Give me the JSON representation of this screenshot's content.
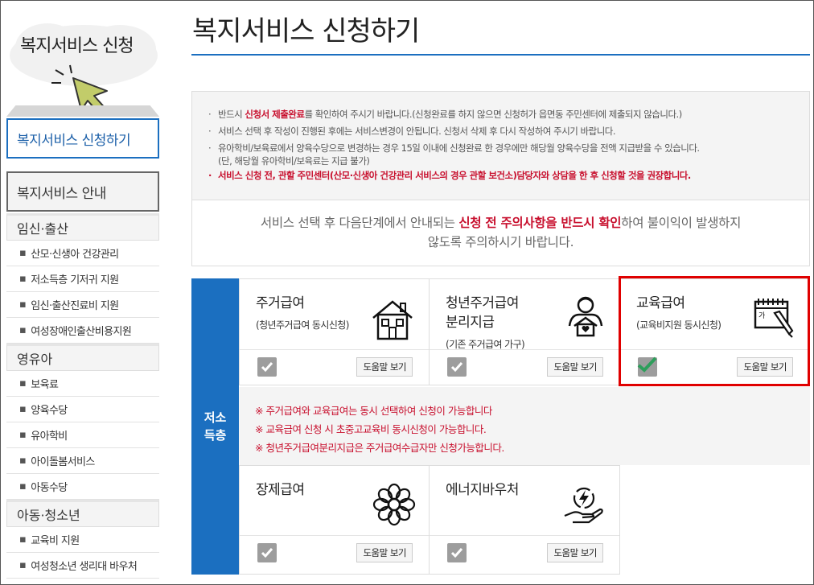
{
  "sidebar": {
    "title": "복지서비스 신청",
    "active_item": "복지서비스 신청하기",
    "guide_header": "복지서비스 안내",
    "categories": [
      {
        "label": "임신·출산",
        "items": [
          "산모·신생아 건강관리",
          "저소득층 기저귀 지원",
          "임신·출산진료비 지원",
          "여성장애인출산비용지원"
        ]
      },
      {
        "label": "영유아",
        "items": [
          "보육료",
          "양육수당",
          "유아학비",
          "아이돌봄서비스",
          "아동수당"
        ]
      },
      {
        "label": "아동·청소년",
        "items": [
          "교육비 지원",
          "여성청소년 생리대 바우처"
        ]
      }
    ]
  },
  "main": {
    "title": "복지서비스 신청하기",
    "notice": {
      "line1_pre": "반드시 ",
      "line1_red": "신청서 제출완료",
      "line1_post": "를 확인하여 주시기 바랍니다.(신청완료를 하지 않으면 신청허가 읍면동 주민센터에 제출되지 않습니다.)",
      "line2": "서비스 선택 후 작성이 진행된 후에는 서비스변경이 안됩니다. 신청서 삭제 후 다시 작성하여 주시기 바랍니다.",
      "line3": "유아학비/보육료에서 양육수당으로 변경하는 경우 15일 이내에 신청완료 한 경우에만 해당월 양육수당을 전액 지급받을 수 있습니다.",
      "line3_sub": "(단, 해당월 유아학비/보육료는 지급 불가)",
      "line4": "서비스 신청 전, 관할 주민센터(산모·신생아 건강관리 서비스의 경우 관할 보건소)담당자와 상담을 한 후 신청할 것을 권장합니다.",
      "bottom_pre": "서비스 선택 후 다음단계에서 안내되는 ",
      "bottom_red": "신청 전 주의사항을 반드시 확인",
      "bottom_post": "하여 불이익이 발생하지",
      "bottom_line2": "않도록 주의하시기 바랍니다."
    },
    "category_label_1": "저소",
    "category_label_2": "득층",
    "help_label": "도움말 보기",
    "cards": [
      {
        "name": "주거급여",
        "note": "(청년주거급여 동시신청)",
        "icon": "house-icon",
        "checked": false
      },
      {
        "name_1": "청년주거급여",
        "name_2": "분리지급",
        "note": "(기존 주거급여 가구)",
        "icon": "youth-house-icon",
        "checked": false
      },
      {
        "name": "교육급여",
        "note": "(교육비지원 동시신청)",
        "icon": "notebook-pen-icon",
        "checked": true
      },
      {
        "name": "장제급여",
        "icon": "flower-icon",
        "checked": false
      },
      {
        "name": "에너지바우처",
        "icon": "energy-hand-icon",
        "checked": false
      }
    ],
    "rules": [
      "※ 주거급여와 교육급여는 동시 선택하여 신청이 가능합니다",
      "※ 교육급여 신청 시 초중고교육비 동시신청이 가능합니다.",
      "※ 청년주거급여분리지급은 주거급여수급자만 신청가능합니다."
    ],
    "accent_color": "#1b6fc0",
    "highlight_color": "#e00000",
    "check_color": "#2e9e5b"
  }
}
